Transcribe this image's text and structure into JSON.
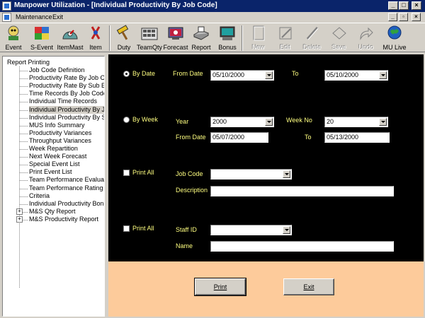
{
  "window": {
    "title": "Manpower Utilization - [Individual Productivity By Job Code]"
  },
  "menu": {
    "items": [
      "Maintenance",
      "Exit"
    ]
  },
  "toolbar": {
    "buttons": [
      {
        "label": "Event",
        "icon": "event-icon"
      },
      {
        "label": "S-Event",
        "icon": "s-event-icon"
      },
      {
        "label": "ItemMast",
        "icon": "item-master-icon"
      },
      {
        "label": "Item",
        "icon": "item-icon"
      },
      {
        "label": "Duty",
        "icon": "duty-icon"
      },
      {
        "label": "TeamQty",
        "icon": "team-qty-icon"
      },
      {
        "label": "Forecast",
        "icon": "forecast-icon"
      },
      {
        "label": "Report",
        "icon": "report-icon"
      },
      {
        "label": "Bonus",
        "icon": "bonus-icon"
      },
      {
        "label": "New",
        "icon": "new-icon"
      },
      {
        "label": "Edit",
        "icon": "edit-icon"
      },
      {
        "label": "Delete",
        "icon": "delete-icon"
      },
      {
        "label": "Save",
        "icon": "save-icon"
      },
      {
        "label": "Undo",
        "icon": "undo-icon"
      },
      {
        "label": "MU Live",
        "icon": "mu-live-icon"
      }
    ]
  },
  "tree": {
    "root": "Report Printing",
    "items": [
      "Job Code Definition",
      "Productivity Rate By Job Code",
      "Productivity Rate By Sub Event",
      "Time Records By Job Code",
      "Individual Time Records",
      "Individual Productivity By Job",
      "Individual Productivity By Sub",
      "MUS Info Summary",
      "Productivity Variances",
      "Throughput Variances",
      "Week Repartition",
      "Next Week Forecast",
      "Special Event List",
      "Print Event List",
      "Team Performance Evaluation",
      "Team Performance Rating",
      "Criteria",
      "Individual Productivity Bonus S"
    ],
    "groups": [
      "M&S Qty Report",
      "M&S Productivity Report"
    ]
  },
  "form": {
    "by_date": {
      "label": "By Date",
      "from_label": "From Date",
      "from_value": "05/10/2000",
      "to_label": "To",
      "to_value": "05/10/2000"
    },
    "by_week": {
      "label": "By Week",
      "year_label": "Year",
      "year_value": "2000",
      "week_label": "Week No",
      "week_value": "20",
      "from_label": "From Date",
      "from_value": "05/07/2000",
      "to_label": "To",
      "to_value": "05/13/2000"
    },
    "job": {
      "print_all_label": "Print All",
      "job_code_label": "Job Code",
      "job_code_value": "",
      "description_label": "Description",
      "description_value": ""
    },
    "staff": {
      "print_all_label": "Print All",
      "staff_id_label": "Staff ID",
      "staff_id_value": "",
      "name_label": "Name",
      "name_value": ""
    }
  },
  "buttons": {
    "print": "Print",
    "exit": "Exit"
  }
}
